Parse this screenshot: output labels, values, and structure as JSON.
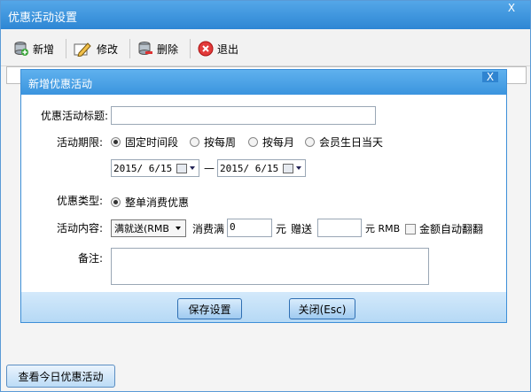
{
  "window": {
    "title": "优惠活动设置",
    "close_glyph": "X"
  },
  "toolbar": {
    "add": "新增",
    "edit": "修改",
    "delete": "删除",
    "exit": "退出"
  },
  "bottom_button": "查看今日优惠活动",
  "dialog": {
    "title": "新增优惠活动",
    "close_glyph": "X",
    "title_label": "优惠活动标题:",
    "title_value": "",
    "period_label": "活动期限:",
    "period_options": [
      "固定时间段",
      "按每周",
      "按每月",
      "会员生日当天"
    ],
    "period_selected": 0,
    "start_date": "2015/ 6/15",
    "end_date": "2015/ 6/15",
    "date_sep": "—",
    "type_label": "优惠类型:",
    "type_option": "整单消费优惠",
    "content_label": "活动内容:",
    "content_select": "满就送(RMB",
    "spend_label": "消费满",
    "spend_value": "0",
    "unit_yuan": "元",
    "gift_label": "赠送",
    "gift_value": "",
    "unit_rmb": "元 RMB",
    "auto_double": "金额自动翻翻",
    "note_label": "备注:",
    "note_value": "",
    "save_button": "保存设置",
    "close_button": "关闭(Esc)"
  }
}
